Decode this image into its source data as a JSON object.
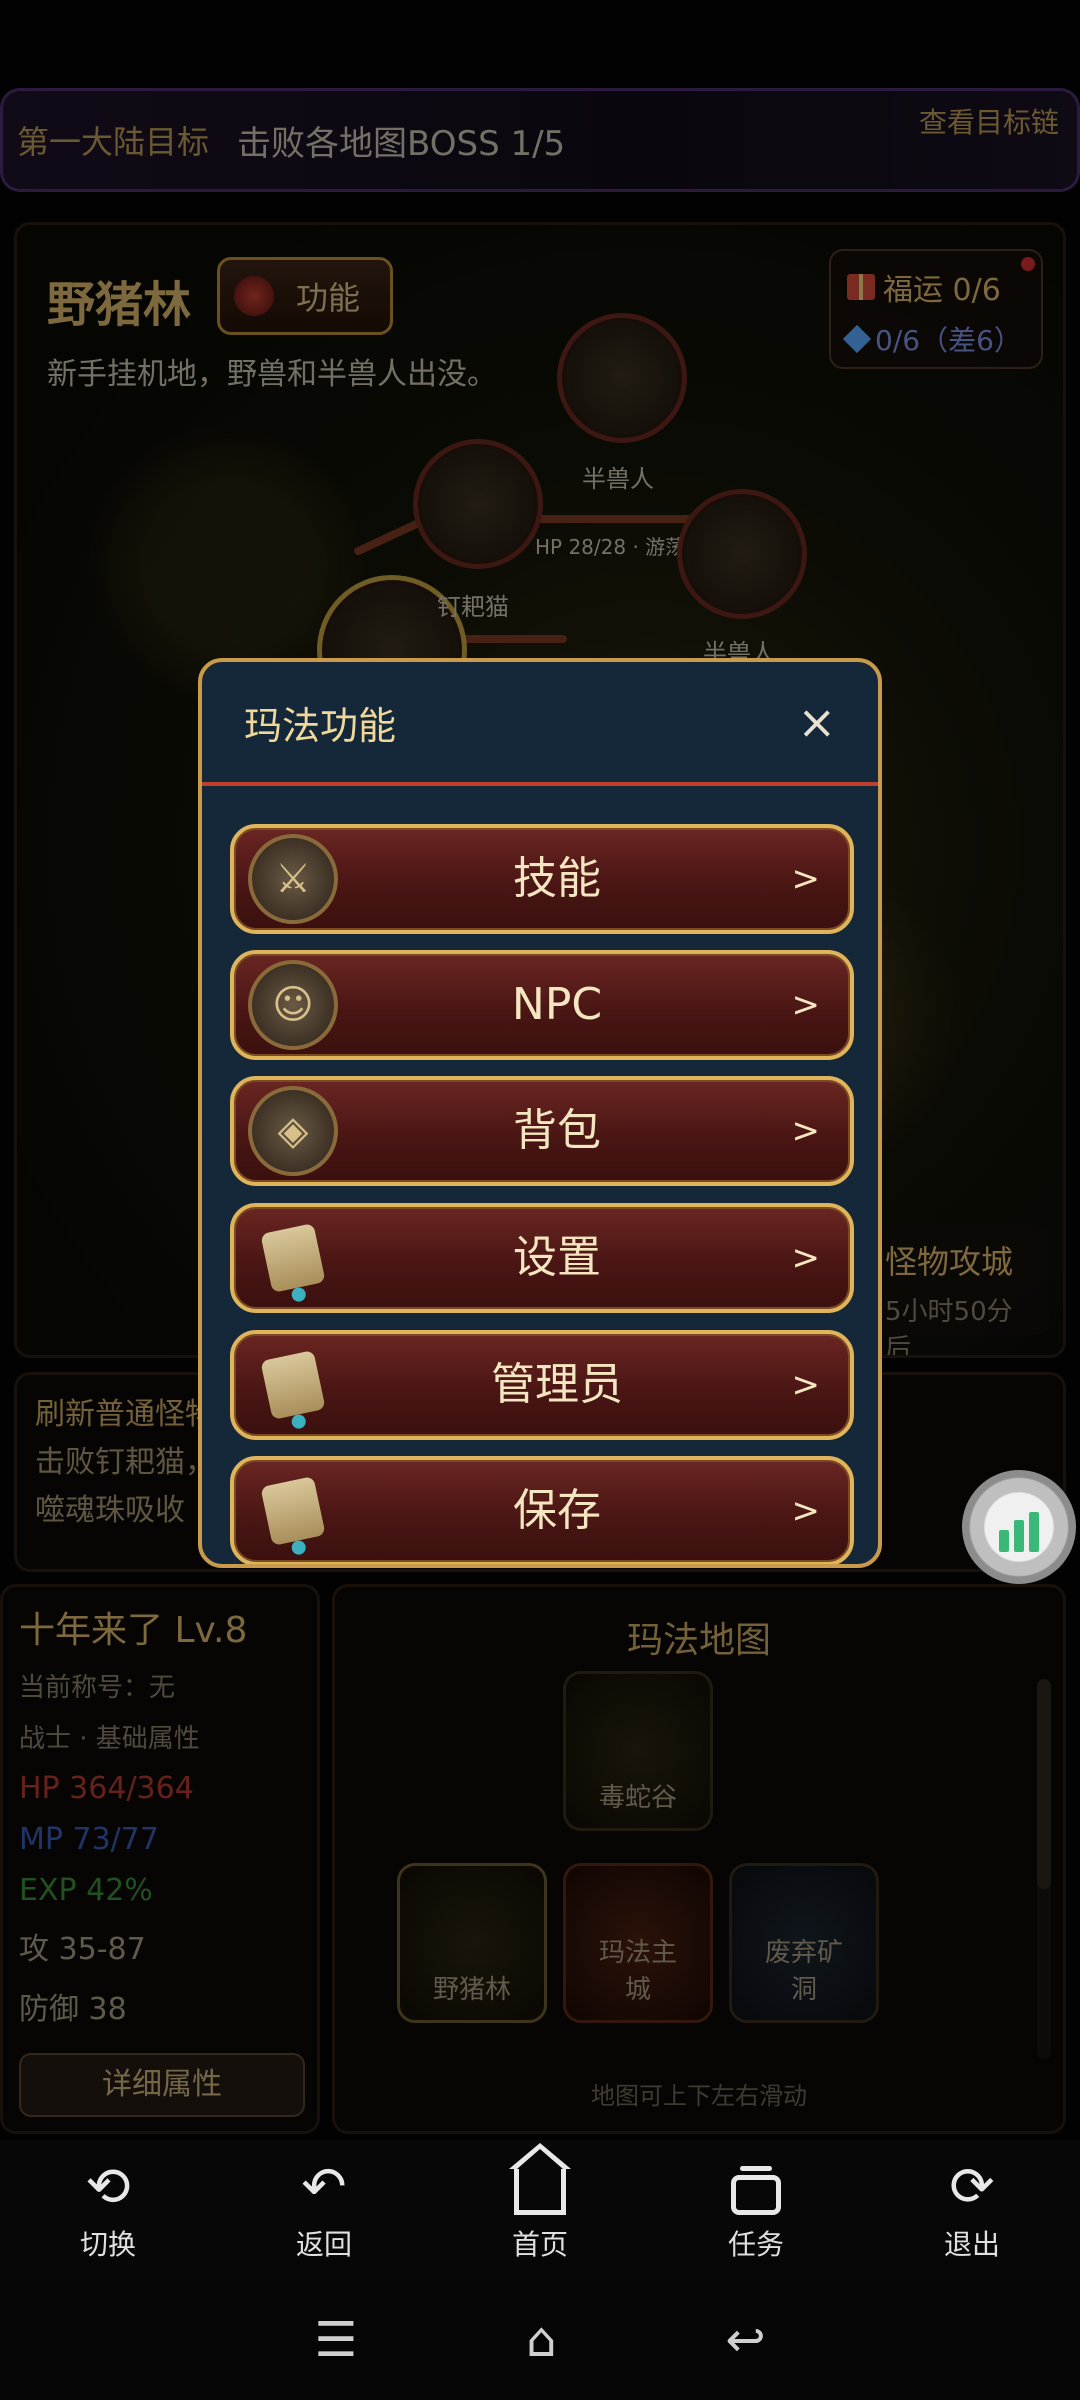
{
  "objective": {
    "title": "第一大陆目标",
    "text": "击败各地图BOSS 1/5",
    "link": "查看目标链"
  },
  "zone": {
    "name": "野猪林",
    "function_button": "功能",
    "description": "新手挂机地，野兽和半兽人出没。",
    "fortune": "福运 0/6",
    "gems": "0/6（差6）",
    "nodes": {
      "orc": "半兽人",
      "hp_info": "HP 28/28 · 游荡中",
      "target_cat": "钉耙猫",
      "orc2": "半兽人"
    },
    "monster_siege": {
      "title": "怪物攻城",
      "time": "5小时50分后"
    }
  },
  "refresh_panel": {
    "line1": "刷新普通怪物",
    "line2": "击败钉耙猫，",
    "line3": "噬魂珠吸收"
  },
  "modal": {
    "title": "玛法功能",
    "close": "×",
    "items": [
      {
        "label": "技能",
        "arrow": ">"
      },
      {
        "label": "NPC",
        "arrow": ">"
      },
      {
        "label": "背包",
        "arrow": ">"
      },
      {
        "label": "设置",
        "arrow": ">"
      },
      {
        "label": "管理员",
        "arrow": ">"
      },
      {
        "label": "保存",
        "arrow": ">"
      }
    ]
  },
  "character": {
    "name": "十年来了 Lv.8",
    "title": "当前称号：无",
    "class": "战士 · 基础属性",
    "hp": "HP 364/364",
    "mp": "MP 73/77",
    "exp": "EXP 42%",
    "attack": "攻 35-87",
    "defense": "防御 38",
    "detail_button": "详细属性"
  },
  "world_map": {
    "title": "玛法地图",
    "tiles": {
      "snake_valley": "毒蛇谷",
      "boar_forest": "野猪林",
      "mafa_city": "玛法主城",
      "mine": "废弃矿洞"
    },
    "hint": "地图可上下左右滑动"
  },
  "bottom_nav": {
    "switch": "切换",
    "back": "返回",
    "home": "首页",
    "tasks": "任务",
    "exit": "退出"
  },
  "colors": {
    "modal_bg": "#14283a",
    "modal_border": "#c99a4a",
    "menu_button": "#5a1c18",
    "gold_text": "#d9b56b"
  }
}
